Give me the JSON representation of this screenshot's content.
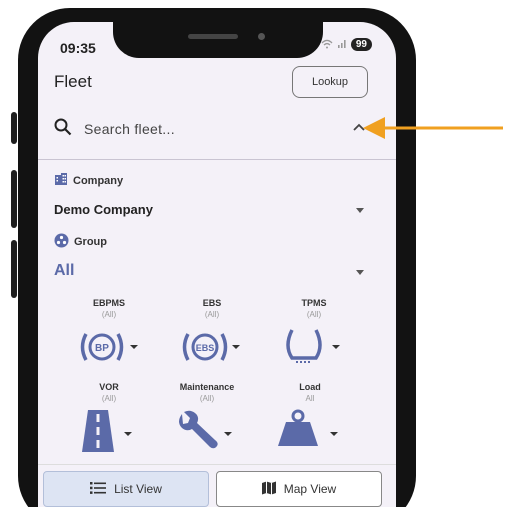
{
  "status_bar": {
    "time": "09:35",
    "battery": "99"
  },
  "header": {
    "title": "Fleet",
    "lookup_label": "Lookup"
  },
  "search": {
    "placeholder": "Search fleet..."
  },
  "filters": {
    "company": {
      "label": "Company",
      "value": "Demo Company"
    },
    "group": {
      "label": "Group",
      "value": "All"
    }
  },
  "indicators": [
    {
      "title": "EBPMS",
      "subtitle": "(All)",
      "icon": "bp-brake-icon",
      "icon_text": "BP"
    },
    {
      "title": "EBS",
      "subtitle": "(All)",
      "icon": "ebs-icon",
      "icon_text": "EBS"
    },
    {
      "title": "TPMS",
      "subtitle": "(All)",
      "icon": "tyre-pressure-icon",
      "icon_text": ""
    },
    {
      "title": "VOR",
      "subtitle": "(All)",
      "icon": "road-icon",
      "icon_text": ""
    },
    {
      "title": "Maintenance",
      "subtitle": "(All)",
      "icon": "wrench-icon",
      "icon_text": ""
    },
    {
      "title": "Load",
      "subtitle": "All",
      "icon": "weight-icon",
      "icon_text": ""
    }
  ],
  "bottom_tabs": {
    "list_label": "List View",
    "map_label": "Map View"
  },
  "colors": {
    "accent": "#5b6aa8",
    "arrow": "#f0a020",
    "active_tab_bg": "#dde4f3"
  }
}
